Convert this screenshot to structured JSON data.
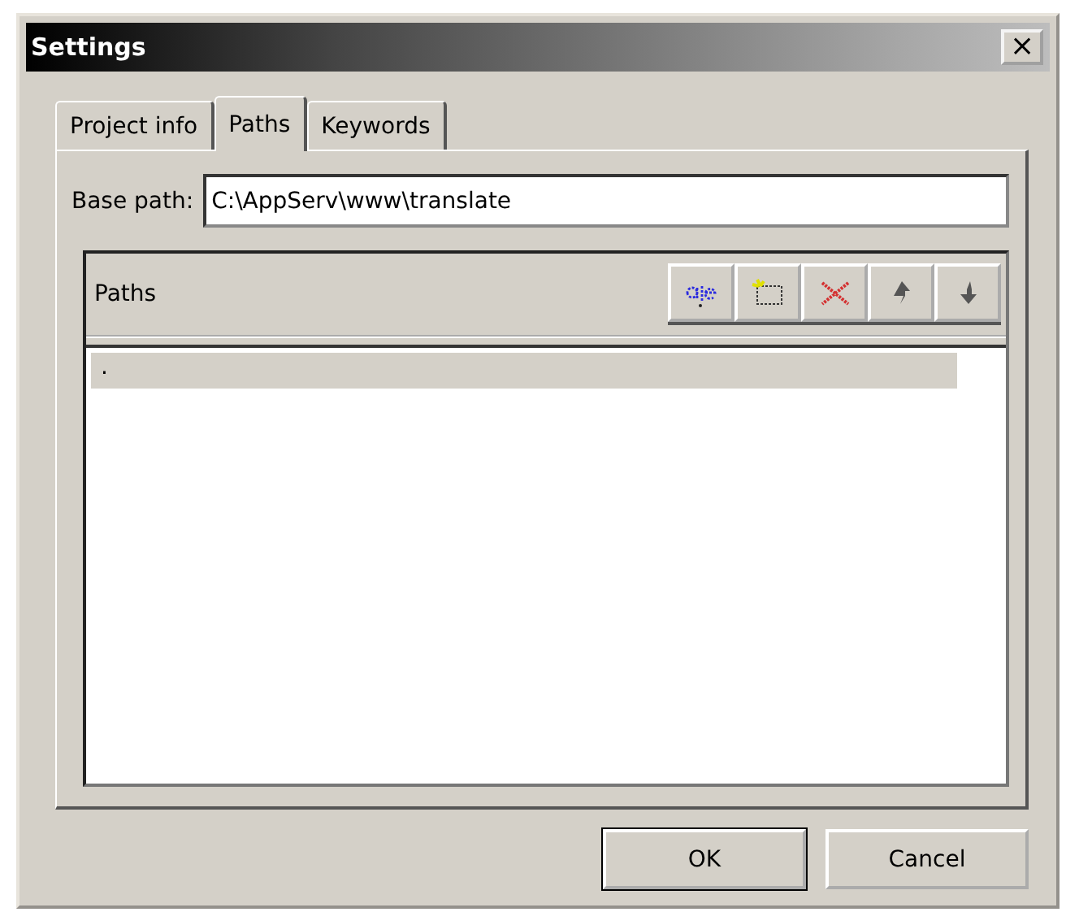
{
  "window": {
    "title": "Settings",
    "close": "×"
  },
  "tabs": [
    {
      "label": "Project info",
      "selected": false
    },
    {
      "label": "Paths",
      "selected": true
    },
    {
      "label": "Keywords",
      "selected": false
    }
  ],
  "base_path": {
    "label": "Base path:",
    "value": "C:\\AppServ\\www\\translate"
  },
  "paths_panel": {
    "title": "Paths",
    "toolbar": [
      {
        "kind": "rename"
      },
      {
        "kind": "new"
      },
      {
        "kind": "delete"
      },
      {
        "kind": "up"
      },
      {
        "kind": "down"
      }
    ],
    "rows": [
      {
        "text": ".",
        "selected": true
      }
    ]
  },
  "buttons": [
    {
      "label": "OK",
      "default": true
    },
    {
      "label": "Cancel",
      "default": false
    }
  ]
}
